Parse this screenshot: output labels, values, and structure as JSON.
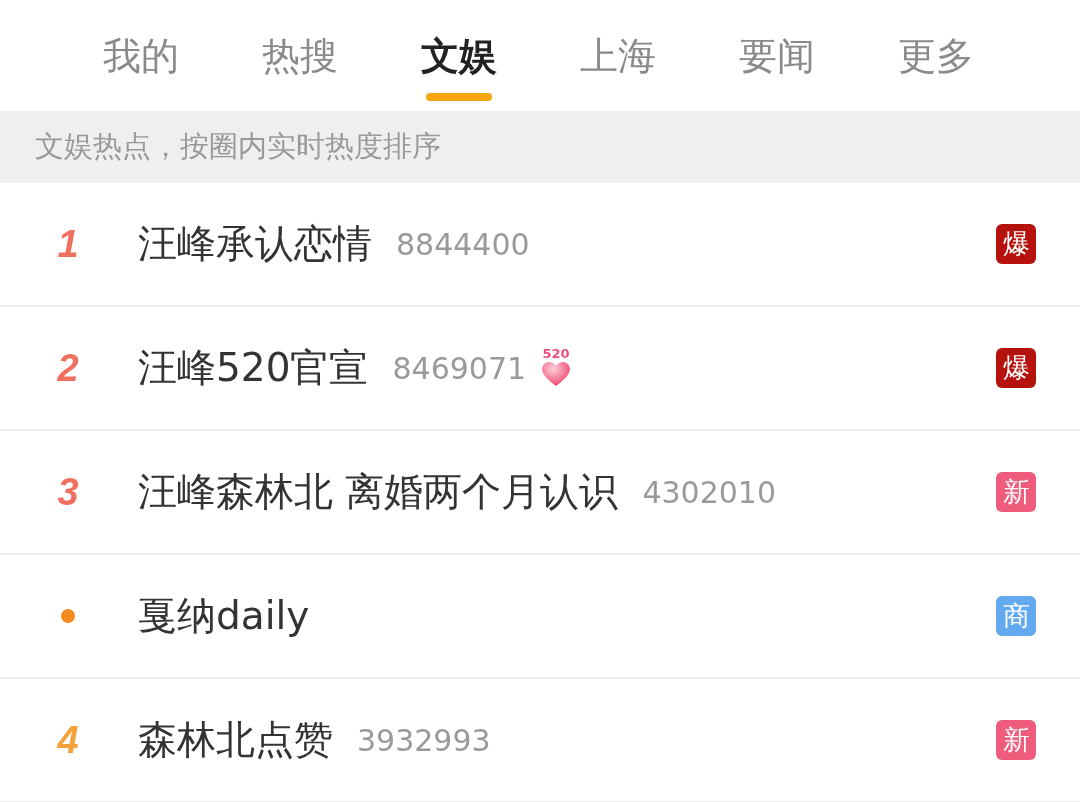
{
  "tabs": [
    {
      "label": "我的",
      "selected": false
    },
    {
      "label": "热搜",
      "selected": false
    },
    {
      "label": "文娱",
      "selected": true
    },
    {
      "label": "上海",
      "selected": false
    },
    {
      "label": "要闻",
      "selected": false
    },
    {
      "label": "更多",
      "selected": false
    }
  ],
  "notice": "文娱热点，按圈内实时热度排序",
  "items": [
    {
      "rank": {
        "kind": "number",
        "text": "1",
        "color": "#f0705f"
      },
      "title": "汪峰承认恋情",
      "count": "8844400",
      "badge": {
        "text": "爆",
        "color": "#b5120e"
      }
    },
    {
      "rank": {
        "kind": "number",
        "text": "2",
        "color": "#f0705f"
      },
      "title": "汪峰520官宣",
      "count": "8469071",
      "emoji": {
        "kind": "heart",
        "text": "520"
      },
      "badge": {
        "text": "爆",
        "color": "#b5120e"
      }
    },
    {
      "rank": {
        "kind": "number",
        "text": "3",
        "color": "#f0705f"
      },
      "title": "汪峰森林北 离婚两个月认识",
      "count": "4302010",
      "badge": {
        "text": "新",
        "color": "#ee5b7b"
      }
    },
    {
      "rank": {
        "kind": "dot",
        "color": "#f28a1e"
      },
      "title": "戛纳daily",
      "badge": {
        "text": "商",
        "color": "#63a9ef"
      }
    },
    {
      "rank": {
        "kind": "number",
        "text": "4",
        "color": "#f3a33a"
      },
      "title": "森林北点赞",
      "count": "3932993",
      "badge": {
        "text": "新",
        "color": "#ee5b7b"
      }
    }
  ]
}
